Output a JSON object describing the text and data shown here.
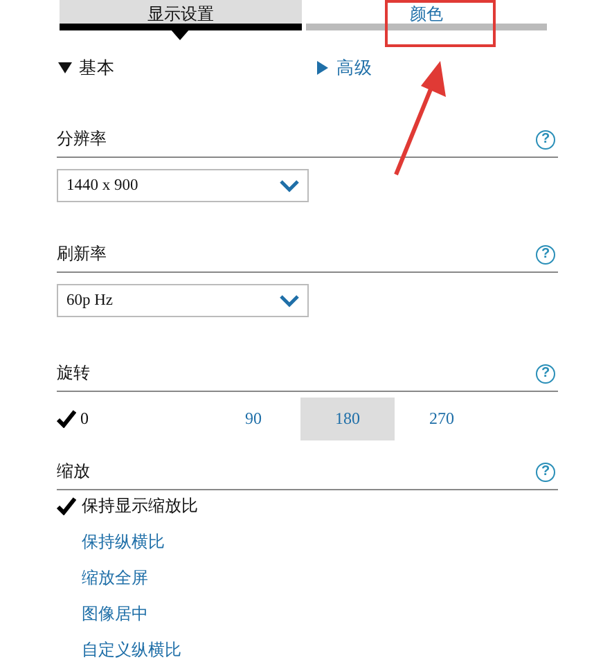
{
  "tabs": [
    {
      "label": "显示设置",
      "selected": true
    },
    {
      "label": "颜色",
      "selected": false
    }
  ],
  "modes": [
    {
      "label": "基本",
      "expanded": true
    },
    {
      "label": "高级",
      "expanded": false
    }
  ],
  "resolution": {
    "title": "分辨率",
    "help": "?",
    "value": "1440 x 900"
  },
  "refresh_rate": {
    "title": "刷新率",
    "help": "?",
    "value": "60p Hz"
  },
  "rotation": {
    "title": "旋转",
    "help": "?",
    "options": [
      {
        "label": "0",
        "selected": true,
        "hovered": false
      },
      {
        "label": "90",
        "selected": false,
        "hovered": false
      },
      {
        "label": "180",
        "selected": false,
        "hovered": true
      },
      {
        "label": "270",
        "selected": false,
        "hovered": false
      }
    ]
  },
  "scaling": {
    "title": "缩放",
    "help": "?",
    "options": [
      {
        "label": "保持显示缩放比",
        "selected": true
      },
      {
        "label": "保持纵横比",
        "selected": false
      },
      {
        "label": "缩放全屏",
        "selected": false
      },
      {
        "label": "图像居中",
        "selected": false
      },
      {
        "label": "自定义纵横比",
        "selected": false
      }
    ]
  }
}
